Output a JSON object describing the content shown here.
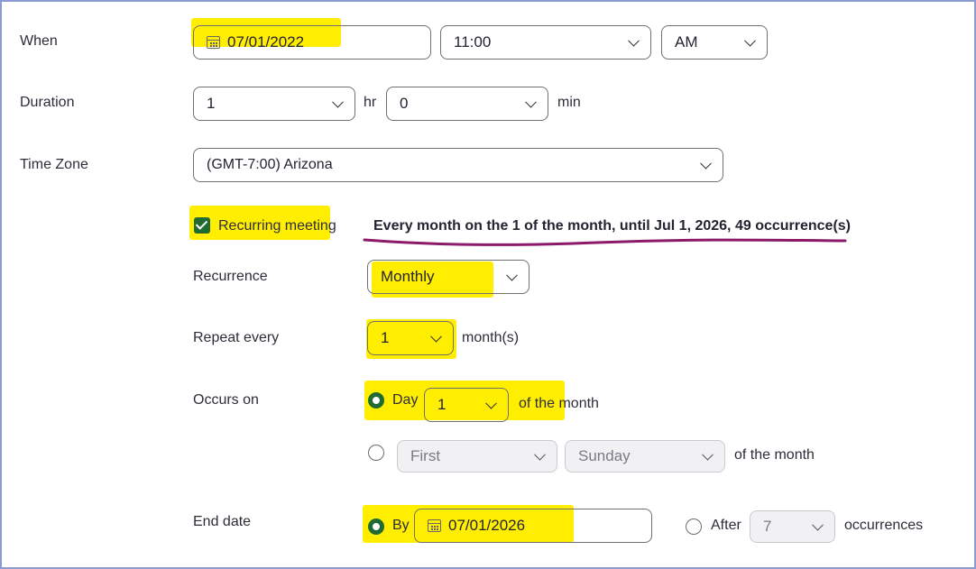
{
  "when": {
    "label": "When",
    "date": "07/01/2022",
    "time": "11:00",
    "ampm": "AM"
  },
  "duration": {
    "label": "Duration",
    "hours": "1",
    "hr_unit": "hr",
    "minutes": "0",
    "min_unit": "min"
  },
  "timezone": {
    "label": "Time Zone",
    "value": "(GMT-7:00) Arizona"
  },
  "recurring": {
    "checkbox_label": "Recurring meeting",
    "checked": true,
    "summary": "Every month on the 1 of the month, until Jul 1, 2026, 49 occurrence(s)"
  },
  "recurrence": {
    "label": "Recurrence",
    "value": "Monthly"
  },
  "repeat_every": {
    "label": "Repeat every",
    "value": "1",
    "unit": "month(s)"
  },
  "occurs_on": {
    "label": "Occurs on",
    "day_option_label": "Day",
    "day_value": "1",
    "day_suffix": "of the month",
    "week_ordinal": "First",
    "week_day": "Sunday",
    "week_suffix": "of the month"
  },
  "end_date": {
    "label": "End date",
    "by_label": "By",
    "by_date": "07/01/2026",
    "after_label": "After",
    "after_value": "7",
    "after_suffix": "occurrences"
  },
  "colors": {
    "highlight": "#ffee00",
    "accent_green": "#1f6b32",
    "underline": "#8b1a6b"
  }
}
